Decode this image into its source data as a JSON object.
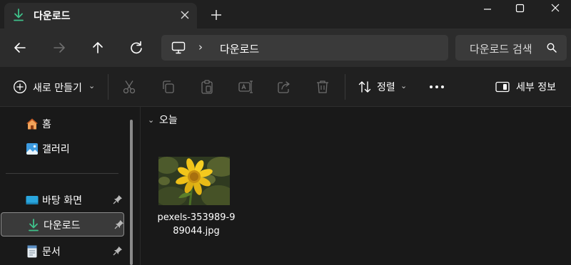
{
  "tab": {
    "title": "다운로드",
    "close_icon": "close-icon",
    "new_tab_icon": "plus-icon"
  },
  "window_controls": {
    "minimize_icon": "minimize-icon",
    "maximize_icon": "maximize-icon",
    "close_icon": "close-icon"
  },
  "nav": {
    "back_icon": "arrow-left-icon",
    "forward_icon": "arrow-right-icon",
    "up_icon": "arrow-up-icon",
    "refresh_icon": "refresh-icon"
  },
  "address": {
    "chevron": "›",
    "location": "다운로드"
  },
  "search": {
    "placeholder": "다운로드 검색"
  },
  "commands": {
    "new_label": "새로 만들기",
    "new_chevron": "⌄",
    "sort_label": "정렬",
    "sort_chevron": "⌄",
    "details_label": "세부 정보",
    "icons": [
      "cut-icon",
      "copy-icon",
      "paste-icon",
      "rename-icon",
      "share-icon",
      "delete-icon",
      "more-icon"
    ]
  },
  "sidebar": {
    "items": [
      {
        "label": "홈",
        "icon": "home-icon"
      },
      {
        "label": "갤러리",
        "icon": "gallery-icon"
      },
      {
        "label": "바탕 화면",
        "icon": "desktop-icon",
        "pinned": true
      },
      {
        "label": "다운로드",
        "icon": "download-icon",
        "pinned": true,
        "selected": true
      },
      {
        "label": "문서",
        "icon": "document-icon",
        "pinned": true
      }
    ]
  },
  "main": {
    "group_chevron": "⌄",
    "group_label": "오늘",
    "files": [
      {
        "name": "pexels-353989-989044.jpg",
        "thumbnail": "sunflower-image"
      }
    ]
  },
  "colors": {
    "accent": "#4cc2ff",
    "download_green": "#3fc18a",
    "titlebar": "#202020",
    "navbar": "#2c2c2c",
    "content": "#191919"
  }
}
